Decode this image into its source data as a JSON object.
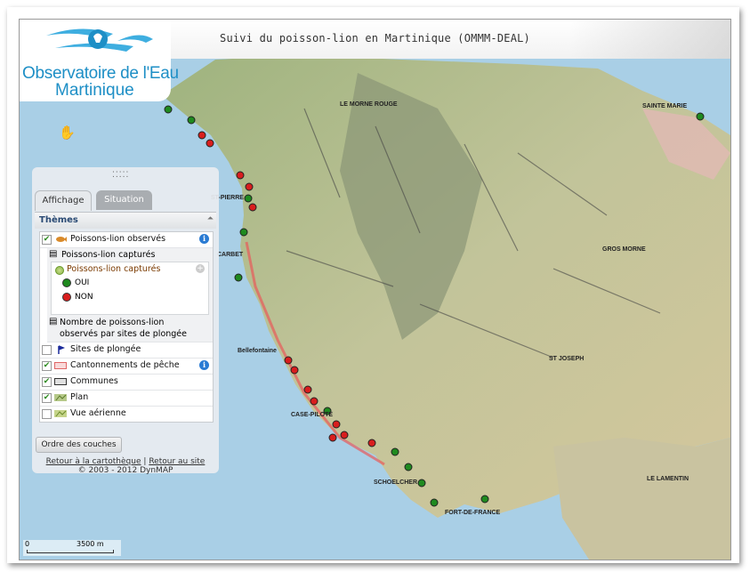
{
  "window": {
    "title": "Suivi du poisson-lion en Martinique (OMMM-DEAL)"
  },
  "logo": {
    "line1": "Observatoire de l'Eau",
    "line2": "Martinique"
  },
  "tabs": [
    {
      "label": "Affichage",
      "active": true
    },
    {
      "label": "Situation",
      "active": false
    }
  ],
  "themes": {
    "title": "Thèmes",
    "layers": [
      {
        "label": "Poissons-lion observés",
        "checked": true,
        "info": true
      },
      {
        "label": "Sites de plongée",
        "checked": false
      },
      {
        "label": "Cantonnements de pêche",
        "checked": true,
        "info": true
      },
      {
        "label": "Communes",
        "checked": true
      },
      {
        "label": "Plan",
        "checked": true
      },
      {
        "label": "Vue aérienne",
        "checked": false
      }
    ],
    "sublayers": {
      "captured_title": "Poissons-lion capturés",
      "captured_radio": "Poissons-lion capturés",
      "legend": [
        {
          "label": "OUI",
          "color": "#1f8a1f"
        },
        {
          "label": "NON",
          "color": "#d81e1e"
        }
      ],
      "count_line1": "Nombre de poissons-lion",
      "count_line2": "observés par sites de plongée"
    }
  },
  "buttons": {
    "layer_order": "Ordre des couches"
  },
  "links": {
    "back_carto": "Retour à la cartothèque",
    "separator": "|",
    "back_site": "Retour au site",
    "copyright": "© 2003 - 2012 DynMAP"
  },
  "scale": {
    "start": "0",
    "end": "3500 m"
  },
  "map_labels": [
    "LE MORNE ROUGE",
    "ST-PIERRE",
    "CARBET",
    "Bellefontaine",
    "CASE-PILOTE",
    "SCHOELCHER",
    "FORT-DE-FRANCE",
    "LE LAMENTIN",
    "SAINTE MARIE",
    "GROS MORNE",
    "ST JOSEPH"
  ],
  "colors": {
    "accent": "#1e8fc6",
    "positive": "#1f8a1f",
    "negative": "#d81e1e",
    "sea": "#a9cfe6"
  }
}
